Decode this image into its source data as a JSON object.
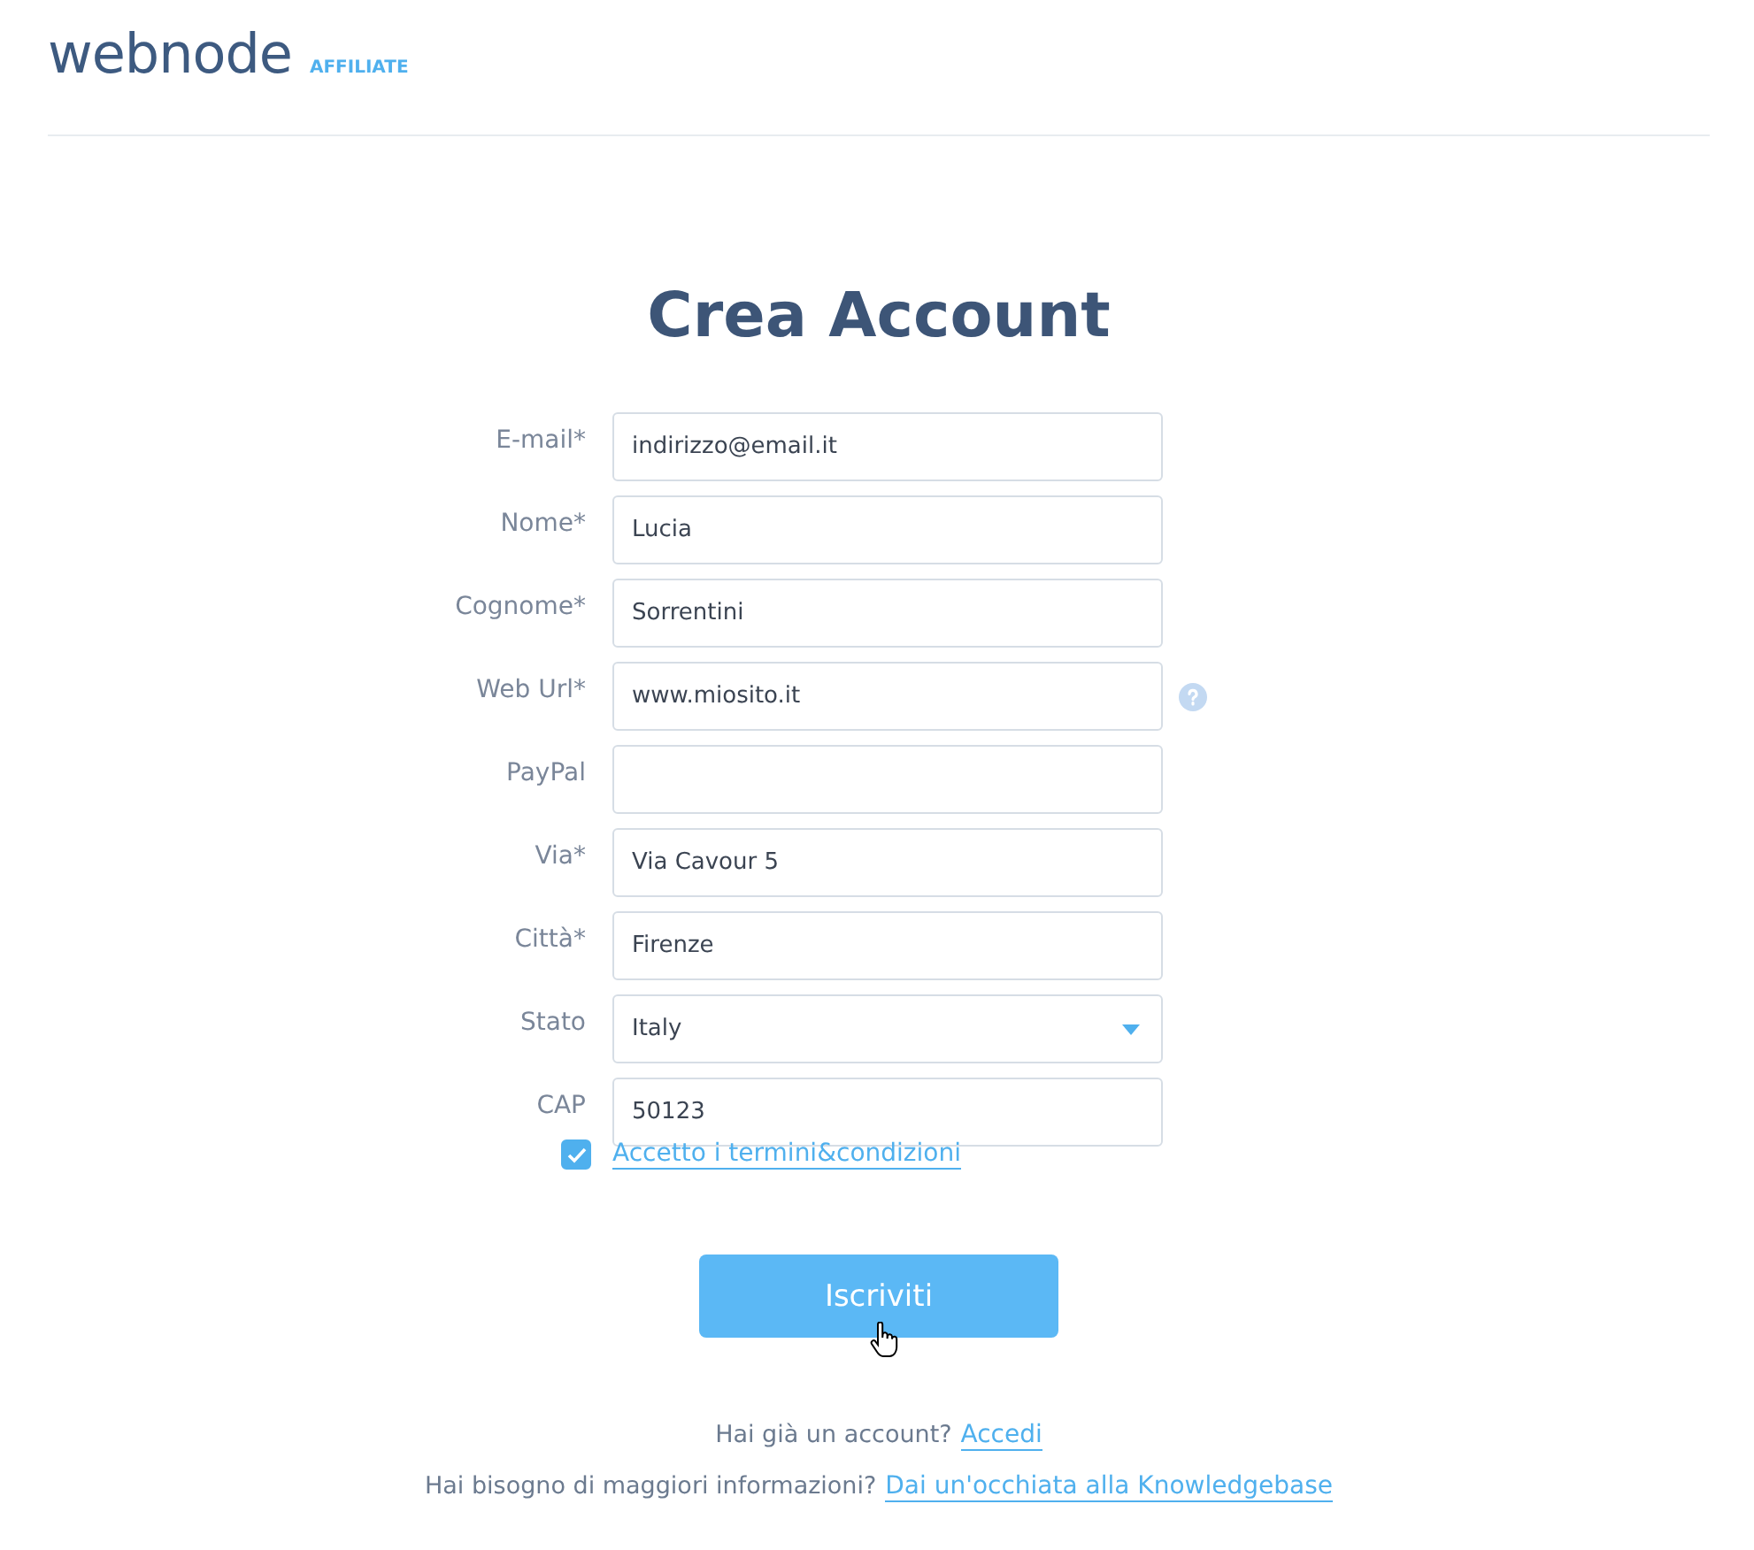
{
  "header": {
    "logo": "webnode",
    "tag": "AFFILIATE"
  },
  "title": "Crea Account",
  "fields": [
    {
      "label": "E-mail*",
      "kind": "text",
      "value": "indirizzo@email.it",
      "help": false
    },
    {
      "label": "Nome*",
      "kind": "text",
      "value": "Lucia",
      "help": false
    },
    {
      "label": "Cognome*",
      "kind": "text",
      "value": "Sorrentini",
      "help": false
    },
    {
      "label": "Web Url*",
      "kind": "text",
      "value": "www.miosito.it",
      "help": true
    },
    {
      "label": "PayPal",
      "kind": "text",
      "help": false
    },
    {
      "label": "Via*",
      "kind": "text",
      "value": "Via Cavour 5",
      "help": false
    },
    {
      "label": "Città*",
      "kind": "text",
      "value": "Firenze",
      "help": false
    },
    {
      "label": "Stato",
      "kind": "select",
      "value": "Italy",
      "help": false
    },
    {
      "label": "CAP",
      "kind": "text",
      "value": "50123",
      "help": false
    }
  ],
  "terms": {
    "label": "Accetto i termini&condizioni",
    "checked": true
  },
  "submit": "Iscriviti",
  "footer": [
    {
      "text": "Hai già un account?",
      "link": "Accedi"
    },
    {
      "text": "Hai bisogno di maggiori informazioni?",
      "link": "Dai un'occhiata alla Knowledgebase"
    }
  ]
}
